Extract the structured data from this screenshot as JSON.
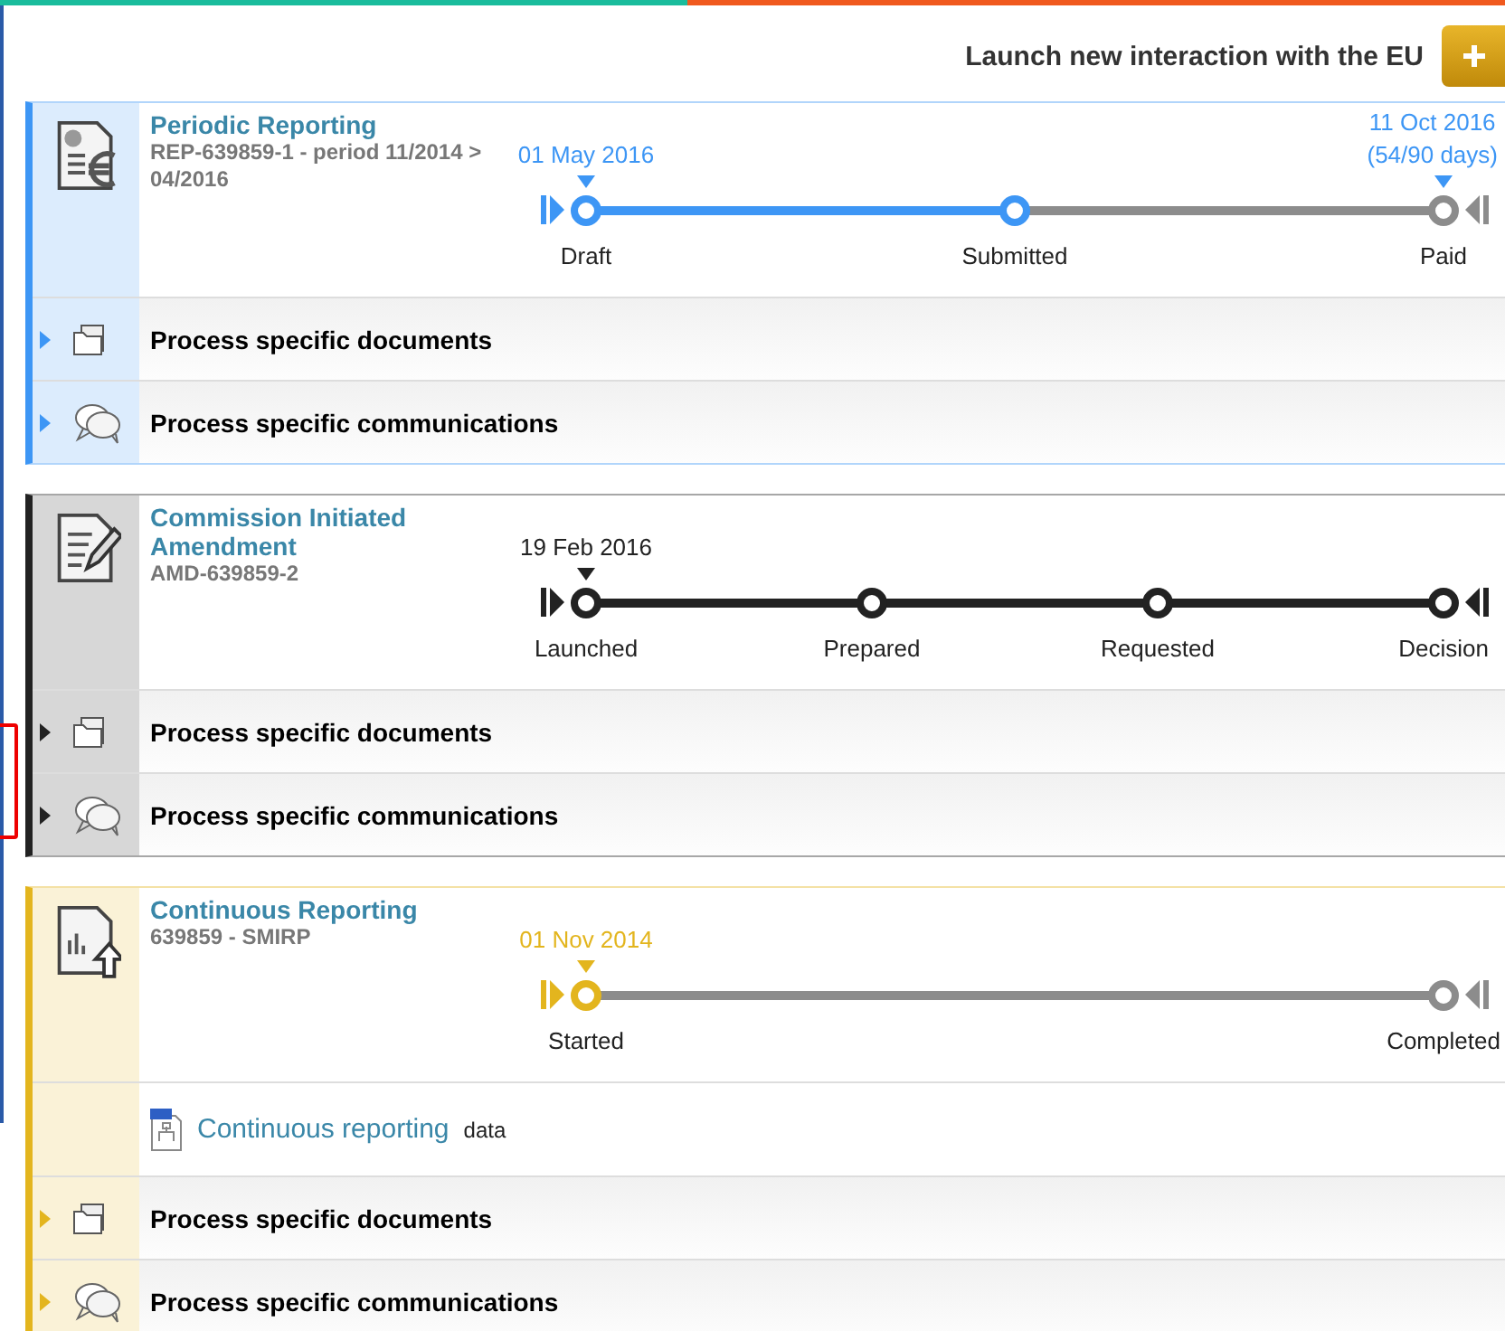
{
  "launch": {
    "label": "Launch new interaction with the EU"
  },
  "processes": [
    {
      "kind": "reporting",
      "color": "#3d96f5",
      "title": "Periodic Reporting",
      "reference": "REP-639859-1 - period 11/2014 > 04/2016",
      "stages": [
        {
          "label": "Draft",
          "reached": true,
          "date": [
            "01 May 2016"
          ]
        },
        {
          "label": "Submitted",
          "reached": true
        },
        {
          "label": "Paid",
          "reached": false,
          "date": [
            "11 Oct 2016",
            "(54/90 days)"
          ]
        }
      ],
      "sections": [
        {
          "kind": "documents",
          "label": "Process specific documents"
        },
        {
          "kind": "communications",
          "label": "Process specific communications"
        }
      ]
    },
    {
      "kind": "amendment",
      "color": "#222222",
      "title": "Commission Initiated Amendment",
      "reference": "AMD-639859-2",
      "stages": [
        {
          "label": "Launched",
          "reached": true,
          "date": [
            "19 Feb 2016"
          ]
        },
        {
          "label": "Prepared",
          "reached": true
        },
        {
          "label": "Requested",
          "reached": true
        },
        {
          "label": "Decision",
          "reached": true
        }
      ],
      "sections": [
        {
          "kind": "documents",
          "label": "Process specific documents"
        },
        {
          "kind": "communications",
          "label": "Process specific communications"
        }
      ]
    },
    {
      "kind": "continuous",
      "color": "#e3b51e",
      "title": "Continuous Reporting",
      "reference": "639859 - SMIRP",
      "stages": [
        {
          "label": "Started",
          "reached": true,
          "date": [
            "01 Nov 2014"
          ]
        },
        {
          "label": "Completed",
          "reached": false
        }
      ],
      "data_link": {
        "link": "Continuous reporting",
        "suffix": "data"
      },
      "sections": [
        {
          "kind": "documents",
          "label": "Process specific documents"
        },
        {
          "kind": "communications",
          "label": "Process specific communications"
        }
      ]
    }
  ]
}
